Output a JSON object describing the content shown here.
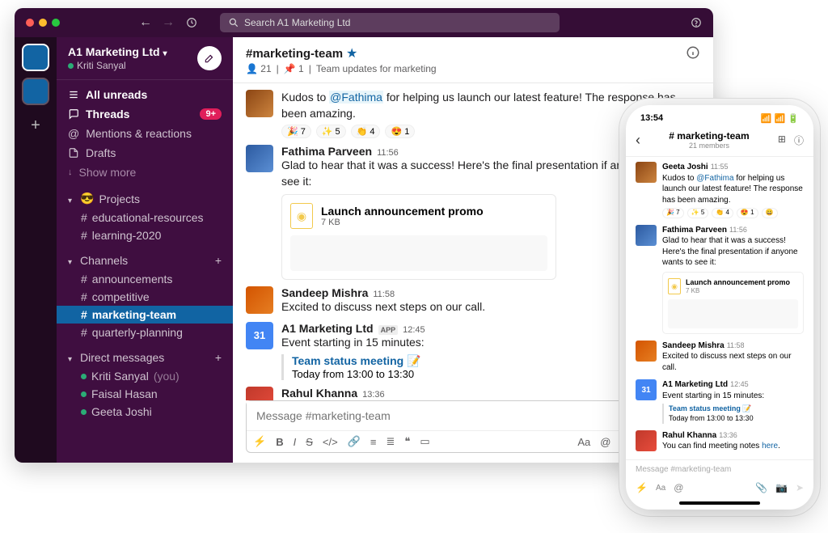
{
  "workspace": {
    "name": "A1 Marketing Ltd",
    "user": "Kriti Sanyal"
  },
  "search": {
    "placeholder": "Search A1 Marketing Ltd"
  },
  "sidebar": {
    "allUnreads": "All unreads",
    "threads": "Threads",
    "threadsBadge": "9+",
    "mentions": "Mentions & reactions",
    "drafts": "Drafts",
    "showMore": "Show more",
    "sections": {
      "projects": {
        "label": "Projects",
        "items": [
          "educational-resources",
          "learning-2020"
        ]
      },
      "channels": {
        "label": "Channels",
        "items": [
          "announcements",
          "competitive",
          "marketing-team",
          "quarterly-planning"
        ],
        "activeIndex": 2
      },
      "dms": {
        "label": "Direct messages",
        "items": [
          {
            "name": "Kriti Sanyal",
            "suffix": "(you)"
          },
          {
            "name": "Faisal Hasan"
          },
          {
            "name": "Geeta Joshi"
          }
        ]
      }
    }
  },
  "channel": {
    "name": "#marketing-team",
    "members": "21",
    "pins": "1",
    "topic": "Team updates for marketing"
  },
  "messages": [
    {
      "author": "Geeta Joshi",
      "time": "11:55",
      "text_pre": "Kudos to ",
      "mention": "@Fathima",
      "text_post": " for helping us launch our latest feature! The response has been amazing.",
      "reactions": [
        {
          "e": "🎉",
          "c": "7"
        },
        {
          "e": "✨",
          "c": "5"
        },
        {
          "e": "👏",
          "c": "4"
        },
        {
          "e": "😍",
          "c": "1"
        }
      ]
    },
    {
      "author": "Fathima Parveen",
      "time": "11:56",
      "text": "Glad to hear that it was a success! Here's the final presentation if anyone wants to see it:",
      "file": {
        "name": "Launch announcement promo",
        "size": "7 KB"
      }
    },
    {
      "author": "Sandeep Mishra",
      "time": "11:58",
      "text": "Excited to discuss next steps on our call."
    },
    {
      "author": "A1 Marketing Ltd",
      "time": "12:45",
      "app": true,
      "text": "Event starting in 15 minutes:",
      "event": {
        "title": "Team status meeting 📝",
        "time": "Today from 13:00 to 13:30"
      }
    },
    {
      "author": "Rahul Khanna",
      "time": "13:36",
      "text_pre": "You can find meeting notes ",
      "link": "here",
      "text_post": "."
    }
  ],
  "composer": {
    "placeholder": "Message #marketing-team"
  },
  "phone": {
    "time": "13:54",
    "channel": "# marketing-team",
    "members": "21 members",
    "messages": [
      {
        "author": "Geeta Joshi",
        "time": "11:55",
        "text_pre": "Kudos to ",
        "mention": "@Fathima",
        "text_post": " for helping us launch our latest feature! The response has been amazing.",
        "reactions": [
          "🎉 7",
          "✨ 5",
          "👏 4",
          "😍 1",
          "😀"
        ]
      },
      {
        "author": "Fathima Parveen",
        "time": "11:56",
        "text": "Glad to hear that it was a success! Here's the final presentation if anyone wants to see it:",
        "file": {
          "name": "Launch announcement promo",
          "size": "7 KB"
        }
      },
      {
        "author": "Sandeep Mishra",
        "time": "11:58",
        "text": "Excited to discuss next steps on our call."
      },
      {
        "author": "A1 Marketing Ltd",
        "time": "12:45",
        "app": true,
        "text": "Event starting in 15 minutes:",
        "event": {
          "title": "Team status meeting 📝",
          "time": "Today from 13:00 to 13:30"
        }
      },
      {
        "author": "Rahul Khanna",
        "time": "13:36",
        "text_pre": "You can find meeting notes ",
        "link": "here",
        "text_post": "."
      }
    ],
    "composer": "Message #marketing-team"
  },
  "labels": {
    "appTag": "APP",
    "sidebarEmoji": "😎"
  }
}
